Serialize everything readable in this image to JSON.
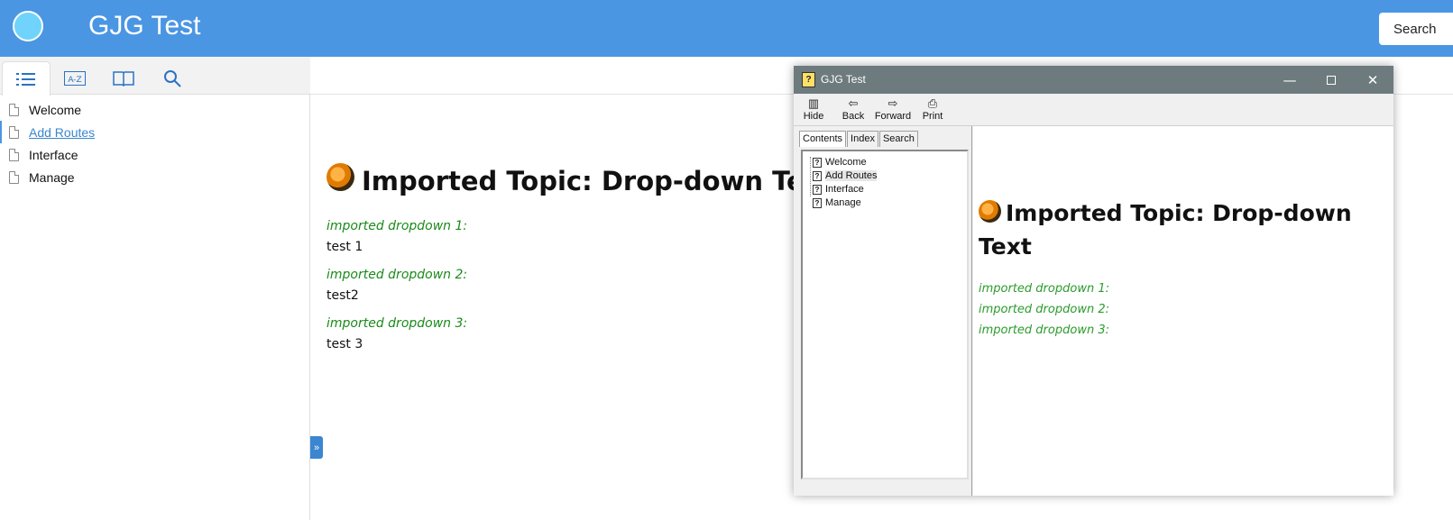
{
  "header": {
    "title": "GJG Test",
    "search_label": "Search",
    "color": "#4a96e3"
  },
  "sidebar": {
    "tabs": [
      {
        "name": "contents",
        "icon": "list-icon"
      },
      {
        "name": "index",
        "icon": "az-icon"
      },
      {
        "name": "glossary",
        "icon": "book-icon"
      },
      {
        "name": "search",
        "icon": "search-icon"
      }
    ],
    "items": [
      {
        "label": "Welcome"
      },
      {
        "label": "Add Routes"
      },
      {
        "label": "Interface"
      },
      {
        "label": "Manage"
      }
    ]
  },
  "main": {
    "title": "Imported Topic: Drop-down Text",
    "dropdowns": [
      {
        "label": "imported dropdown 1:",
        "text": "test 1"
      },
      {
        "label": "imported dropdown 2:",
        "text": "test2"
      },
      {
        "label": "imported dropdown 3:",
        "text": "test 3"
      }
    ]
  },
  "chm": {
    "title": "GJG Test",
    "toolbar": [
      "Hide",
      "Back",
      "Forward",
      "Print"
    ],
    "tabs": [
      "Contents",
      "Index",
      "Search"
    ],
    "tree": [
      "Welcome",
      "Add Routes",
      "Interface",
      "Manage"
    ],
    "topic_title": "Imported Topic: Drop-down Text",
    "dropdowns": [
      "imported dropdown 1:",
      "imported dropdown 2:",
      "imported dropdown 3:"
    ]
  }
}
